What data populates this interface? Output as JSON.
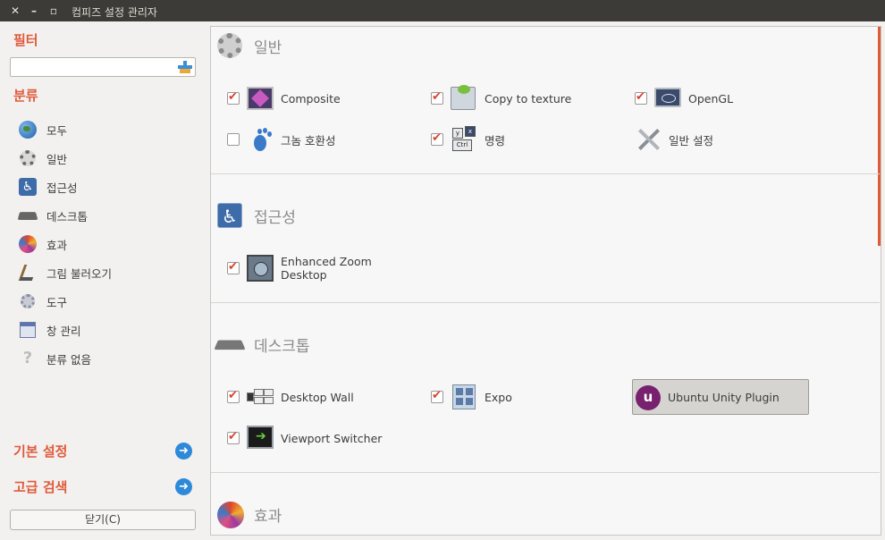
{
  "window": {
    "title": "컴피즈 설정 관리자"
  },
  "sidebar": {
    "filter_heading": "필터",
    "filter_value": "",
    "category_heading": "분류",
    "categories": [
      {
        "label": "모두",
        "icon": "globe-icon"
      },
      {
        "label": "일반",
        "icon": "gear-icon"
      },
      {
        "label": "접근성",
        "icon": "accessibility-icon"
      },
      {
        "label": "데스크톱",
        "icon": "desktop-icon"
      },
      {
        "label": "효과",
        "icon": "effects-icon"
      },
      {
        "label": "그림 불러오기",
        "icon": "image-loading-icon"
      },
      {
        "label": "도구",
        "icon": "tools-icon"
      },
      {
        "label": "창 관리",
        "icon": "window-management-icon"
      },
      {
        "label": "분류 없음",
        "icon": "question-icon"
      }
    ],
    "preferences_label": "기본 설정",
    "advanced_search_label": "고급 검색",
    "close_label": "닫기(C)"
  },
  "main": {
    "sections": [
      {
        "title": "일반",
        "plugins": [
          {
            "label": "Composite",
            "checked": true
          },
          {
            "label": "Copy to texture",
            "checked": true
          },
          {
            "label": "OpenGL",
            "checked": true
          },
          {
            "label": "그놈 호환성",
            "checked": false
          },
          {
            "label": "명령",
            "checked": true
          },
          {
            "label": "일반 설정",
            "checked": null
          }
        ]
      },
      {
        "title": "접근성",
        "plugins": [
          {
            "label_line1": "Enhanced Zoom",
            "label_line2": "Desktop",
            "checked": true
          }
        ]
      },
      {
        "title": "데스크톱",
        "plugins": [
          {
            "label": "Desktop Wall",
            "checked": true
          },
          {
            "label": "Expo",
            "checked": true
          },
          {
            "label": "Ubuntu Unity Plugin",
            "checked": null,
            "icon_text": "u"
          },
          {
            "label": "Viewport Switcher",
            "checked": true
          }
        ]
      },
      {
        "title": "효과",
        "plugins": []
      }
    ],
    "cmd_keys": {
      "y": "y",
      "x": "x",
      "ctrl": "Ctrl"
    }
  },
  "colors": {
    "accent": "#e05a3a",
    "titlebar": "#3c3b37",
    "link_arrow": "#2e8ad8",
    "unity": "#77216f"
  }
}
